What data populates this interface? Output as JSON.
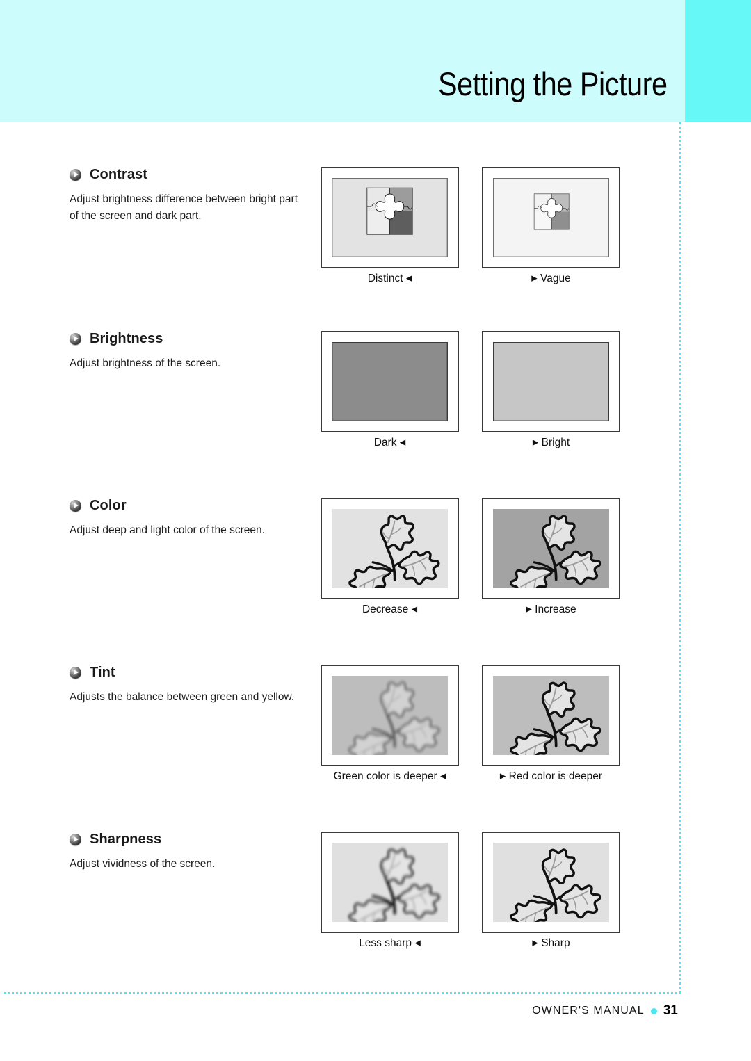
{
  "header": {
    "title": "Setting the Picture",
    "band_color": "#ccfcfc",
    "accent_color": "#66f7f7"
  },
  "sections": [
    {
      "id": "contrast",
      "title": "Contrast",
      "description": "Adjust brightness difference between bright part of the screen and dark part.",
      "left_caption": "Distinct",
      "left_arrow": "◀",
      "right_caption": "Vague",
      "right_arrow": "▶",
      "icon": "play-sphere-icon"
    },
    {
      "id": "brightness",
      "title": "Brightness",
      "description": "Adjust brightness of the screen.",
      "left_caption": "Dark",
      "left_arrow": "◀",
      "right_caption": "Bright",
      "right_arrow": "▶",
      "icon": "play-sphere-icon"
    },
    {
      "id": "color",
      "title": "Color",
      "description": "Adjust deep and light color of the screen.",
      "left_caption": "Decrease",
      "left_arrow": "◀",
      "right_caption": "Increase",
      "right_arrow": "▶",
      "icon": "play-sphere-icon"
    },
    {
      "id": "tint",
      "title": "Tint",
      "description": "Adjusts the balance between green and yellow.",
      "left_caption": "Green color is deeper",
      "left_arrow": "◀",
      "right_caption": "Red color is deeper",
      "right_arrow": "▶",
      "icon": "play-sphere-icon"
    },
    {
      "id": "sharpness",
      "title": "Sharpness",
      "description": "Adjust vividness of the screen.",
      "left_caption": "Less sharp",
      "left_arrow": "◀",
      "right_caption": "Sharp",
      "right_arrow": "▶",
      "icon": "play-sphere-icon"
    }
  ],
  "footer": {
    "label": "OWNER'S MANUAL",
    "page": "31",
    "dot_color": "#4ce8f0"
  }
}
